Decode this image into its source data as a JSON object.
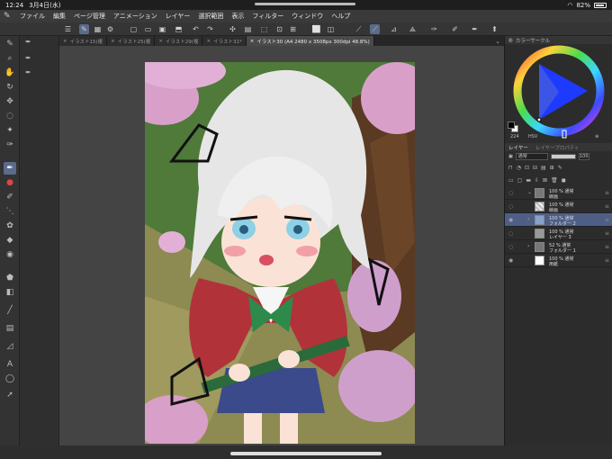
{
  "status": {
    "time": "12:24",
    "date": "3月4日(水)",
    "battery": "82%"
  },
  "menu": [
    "ファイル",
    "編集",
    "ページ管理",
    "アニメーション",
    "レイヤー",
    "選択範囲",
    "表示",
    "フィルター",
    "ウィンドウ",
    "ヘルプ"
  ],
  "tabs": [
    {
      "label": "イラスト15(複",
      "active": false
    },
    {
      "label": "イラスト25(複",
      "active": false
    },
    {
      "label": "イラスト29(複",
      "active": false
    },
    {
      "label": "イラスト31*",
      "active": false
    },
    {
      "label": "イラスト30 (A4 2480 x 3508px 300dpi 48.8%)",
      "active": true
    }
  ],
  "color_panel": {
    "title": "カラーサークル",
    "hue_value": "224",
    "hue_unit": "HSV",
    "main_color": "#000000",
    "sub_color": "#ffffff"
  },
  "layer_panel": {
    "tab_layer": "レイヤー",
    "tab_property": "レイヤープロパティ",
    "blend_mode": "通常",
    "opacity": "100",
    "layers": [
      {
        "line1": "100 % 通常",
        "line2": "線画",
        "thumb": "folder",
        "selected": false
      },
      {
        "line1": "100 % 通常",
        "line2": "線画",
        "thumb": "check",
        "selected": false
      },
      {
        "line1": "100 % 通常",
        "line2": "フォルダー 2",
        "thumb": "folder",
        "selected": true
      },
      {
        "line1": "100 % 通常",
        "line2": "レイヤー 3",
        "thumb": "gray",
        "selected": false
      },
      {
        "line1": "52 % 通常",
        "line2": "フォルダー 1",
        "thumb": "folder",
        "selected": false
      },
      {
        "line1": "100 % 通常",
        "line2": "用紙",
        "thumb": "white",
        "selected": false
      }
    ]
  },
  "colors": {
    "accent": "#5a6b8c",
    "layer_selected": "#4e5f86"
  }
}
